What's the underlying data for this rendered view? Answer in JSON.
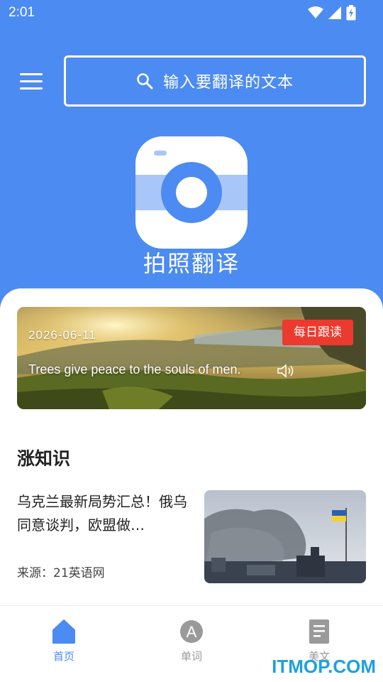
{
  "status_bar": {
    "time": "2:01"
  },
  "search": {
    "placeholder": "输入要翻译的文本"
  },
  "camera": {
    "label": "拍照翻译"
  },
  "daily": {
    "date": "2026-06-11",
    "badge": "每日跟读",
    "quote": "Trees give peace to the souls of men."
  },
  "knowledge": {
    "title": "涨知识",
    "items": [
      {
        "title": "乌克兰最新局势汇总！俄乌同意谈判，欧盟做…",
        "source": "来源：21英语网"
      }
    ]
  },
  "nav": {
    "tabs": [
      {
        "label": "首页",
        "icon": "home-icon",
        "active": true
      },
      {
        "label": "单词",
        "icon": "letter-a-icon",
        "active": false
      },
      {
        "label": "美文",
        "icon": "document-icon",
        "active": false
      }
    ]
  },
  "watermark": "ITMOP.COM",
  "colors": {
    "primary": "#4c8bf1",
    "badge": "#ec3a2e",
    "inactive": "#999999"
  }
}
